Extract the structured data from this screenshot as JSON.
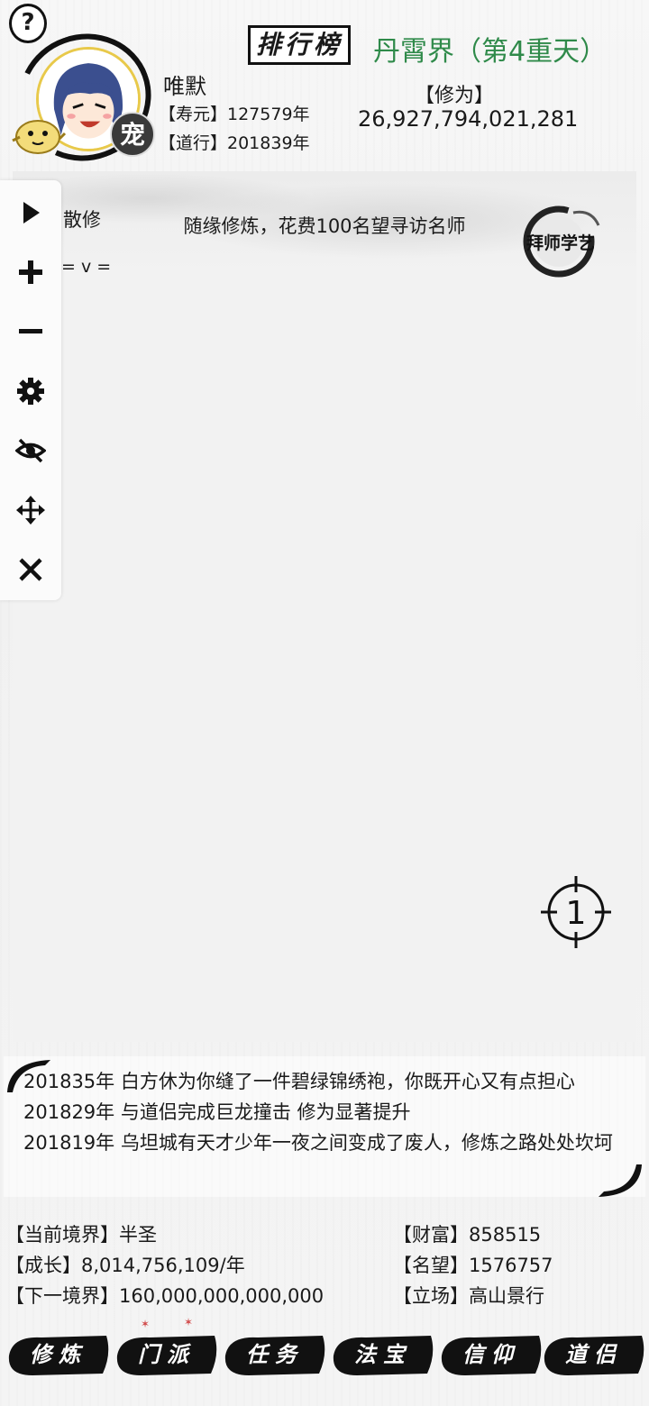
{
  "header": {
    "help_glyph": "?",
    "player_name": "唯默",
    "lifespan": "【寿元】127579年",
    "dao_age": "【道行】201839年",
    "pet_badge": "宠",
    "ranking_button": "排行榜",
    "realm_title": "丹霄界（第4重天）",
    "cultivation_label": "【修为】",
    "cultivation_value": "26,927,794,021,281"
  },
  "main": {
    "rank_label": "散修",
    "emote": "= v =",
    "hint_text": "随缘修炼，花费100名望寻访名师",
    "seal_text": "拜师学艺",
    "target_number": "1"
  },
  "toolbar": {
    "items": [
      {
        "name": "play-icon",
        "icon": "play"
      },
      {
        "name": "plus-icon",
        "icon": "plus"
      },
      {
        "name": "minus-icon",
        "icon": "minus"
      },
      {
        "name": "gear-icon",
        "icon": "gear"
      },
      {
        "name": "eye-off-icon",
        "icon": "eye-off"
      },
      {
        "name": "move-icon",
        "icon": "move"
      },
      {
        "name": "close-icon",
        "icon": "close"
      }
    ]
  },
  "log": {
    "entries": [
      "201835年 白方休为你缝了一件碧绿锦绣袍，你既开心又有点担心",
      "201829年 与道侣完成巨龙撞击 修为显著提升",
      "201819年 乌坦城有天才少年一夜之间变成了废人，修炼之路处处坎坷"
    ]
  },
  "stats": {
    "left": [
      "【当前境界】半圣",
      "【成长】8,014,756,109/年",
      "【下一境界】160,000,000,000,000"
    ],
    "right": [
      "【财富】858515",
      "【名望】1576757",
      "【立场】高山景行"
    ]
  },
  "nav": {
    "items": [
      "修炼",
      "门派",
      "任务",
      "法宝",
      "信仰",
      "道侣"
    ]
  },
  "colors": {
    "realm_green": "#2f8a4a",
    "ink": "#111111",
    "badge_red": "#d14a4a"
  }
}
